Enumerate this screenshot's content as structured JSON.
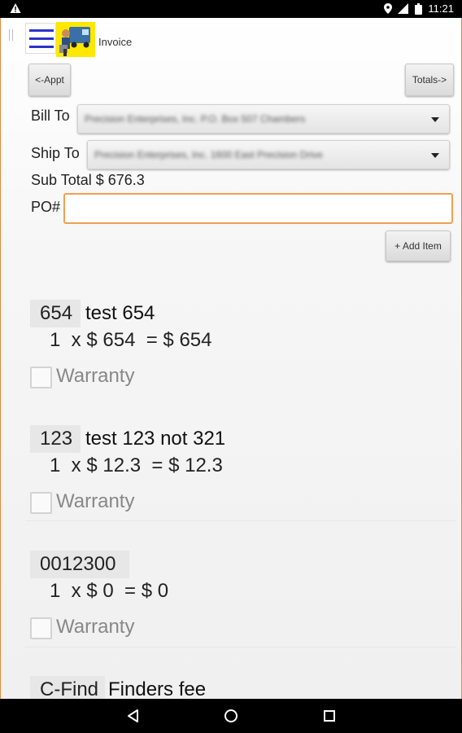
{
  "status_bar": {
    "time": "11:21",
    "icons": [
      "warning-icon",
      "location-icon",
      "signal-icon",
      "battery-icon"
    ]
  },
  "app_bar": {
    "title": "Invoice"
  },
  "buttons": {
    "appt": "<-Appt",
    "totals": "Totals->",
    "add_item": "+ Add Item"
  },
  "form": {
    "bill_to_label": "Bill To",
    "bill_to_value": "Precision Enterprises, Inc. P.O. Box 507 Chambers",
    "ship_to_label": "Ship To",
    "ship_to_value": "Precision Enterprises, Inc. 1600 East Precision Drive",
    "subtotal": "Sub Total $ 676.3",
    "po_label": "PO#",
    "po_value": ""
  },
  "items": [
    {
      "code": "654",
      "desc": "test 654",
      "calc": "1  x $ 654  = $ 654",
      "warranty": "Warranty",
      "warranty_checked": false
    },
    {
      "code": "123",
      "desc": "test 123 not 321",
      "calc": "1  x $ 12.3  = $ 12.3",
      "warranty": "Warranty",
      "warranty_checked": false
    },
    {
      "code": "0012300",
      "desc": "",
      "calc": "1  x $ 0  = $ 0",
      "warranty": "Warranty",
      "warranty_checked": false
    },
    {
      "code": "C-Find",
      "desc": "Finders fee"
    }
  ],
  "colors": {
    "menu_accent": "#2a33c9",
    "logo_bg": "#ffe800",
    "input_focus": "#f0a050"
  }
}
